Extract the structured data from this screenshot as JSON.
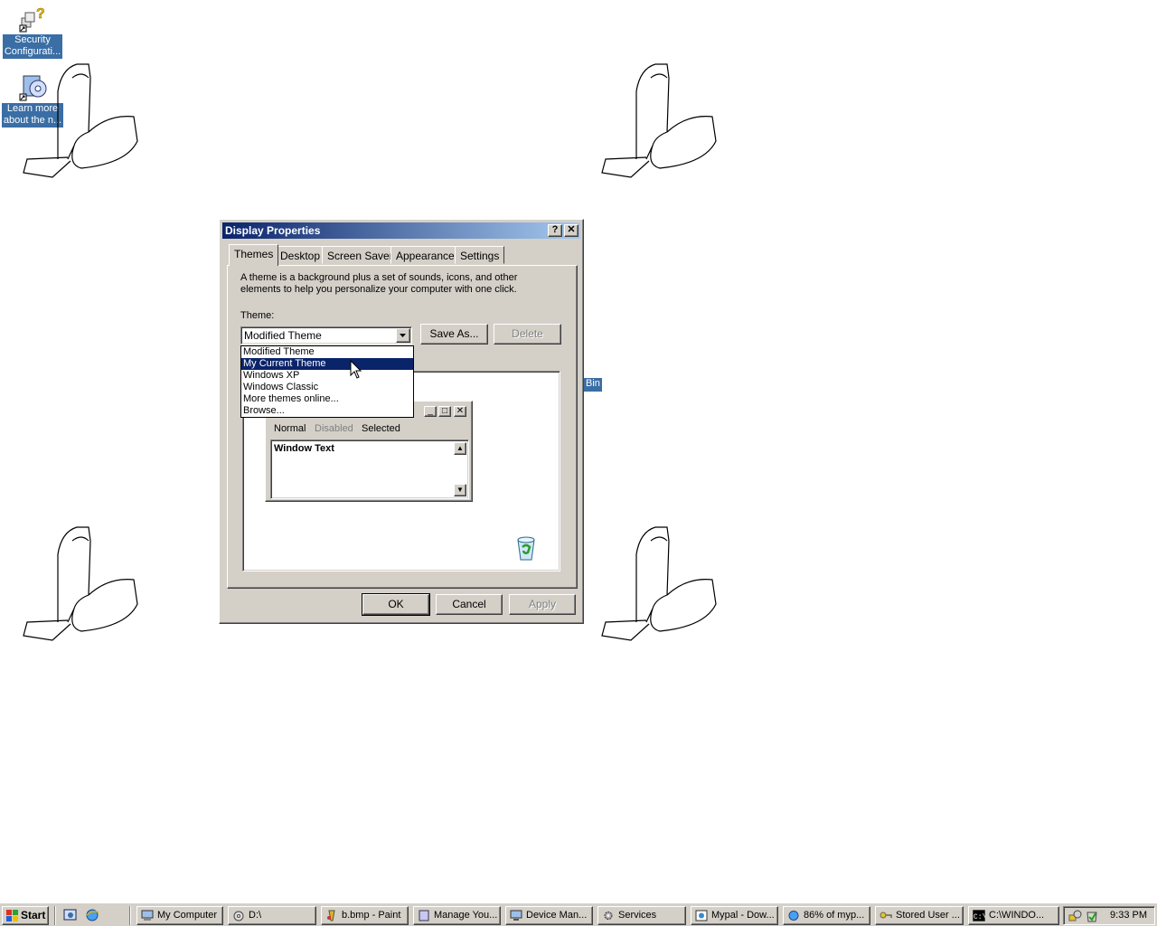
{
  "desktop": {
    "icons": [
      {
        "label_line1": "Security",
        "label_line2": "Configurati..."
      },
      {
        "label_line1": "Learn more",
        "label_line2": "about the n..."
      }
    ],
    "partial_icon_label": "Bin"
  },
  "dialog": {
    "title": "Display Properties",
    "help_glyph": "?",
    "close_glyph": "✕",
    "tabs": [
      "Themes",
      "Desktop",
      "Screen Saver",
      "Appearance",
      "Settings"
    ],
    "active_tab": "Themes",
    "description": "A theme is a background plus a set of sounds, icons, and other elements to help you personalize your computer with one click.",
    "theme_label": "Theme:",
    "theme_value": "Modified Theme",
    "save_as": "Save As...",
    "delete": "Delete",
    "dropdown_options": [
      "Modified Theme",
      "My Current Theme",
      "Windows XP",
      "Windows Classic",
      "More themes online...",
      "Browse..."
    ],
    "dropdown_highlighted": "My Current Theme",
    "preview": {
      "menu_items": [
        "Normal",
        "Disabled",
        "Selected"
      ],
      "window_text": "Window Text"
    },
    "ok": "OK",
    "cancel": "Cancel",
    "apply": "Apply"
  },
  "taskbar": {
    "start": "Start",
    "buttons": [
      "My Computer",
      "D:\\",
      "b.bmp - Paint",
      "Manage You...",
      "Device Man...",
      "Services",
      "Mypal - Dow...",
      "86% of myp...",
      "Stored User ...",
      "C:\\WINDO..."
    ],
    "clock": "9:33 PM"
  },
  "colors": {
    "desktop": "#ffffff",
    "face": "#d4d0c8",
    "title_active": "#0a246a",
    "highlight": "#0a246a",
    "icon_label_bg": "#3a6ea5"
  }
}
